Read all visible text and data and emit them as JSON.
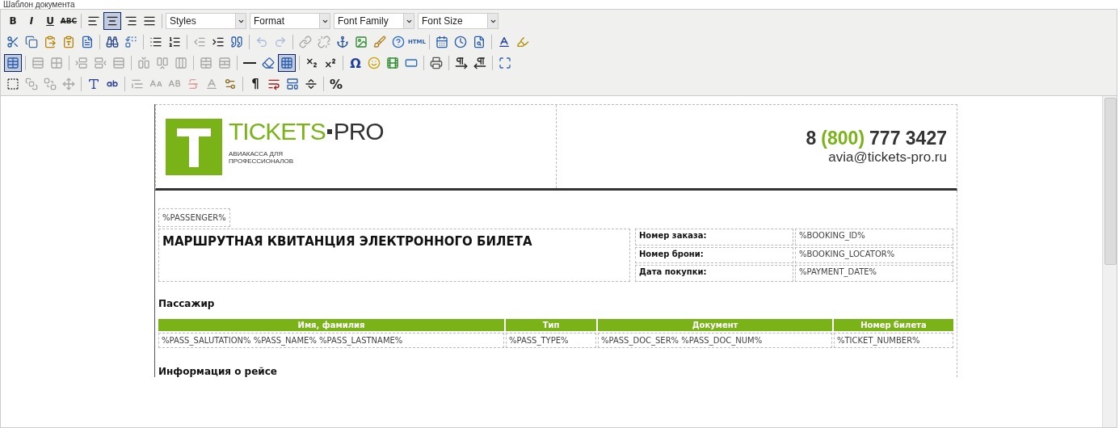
{
  "field_label": "Шаблон документа",
  "toolbar": {
    "rows": [
      [
        [
          {
            "kind": "bold",
            "label": "B",
            "disabled": false,
            "selected": false
          },
          {
            "kind": "italic",
            "label": "I",
            "disabled": false,
            "selected": false
          },
          {
            "kind": "underline",
            "label": "U",
            "disabled": false,
            "selected": false
          },
          {
            "kind": "strike",
            "label": "ABC",
            "disabled": false,
            "selected": false
          }
        ],
        [
          {
            "kind": "align-left",
            "disabled": false,
            "selected": false
          },
          {
            "kind": "align-center",
            "disabled": false,
            "selected": true
          },
          {
            "kind": "align-right",
            "disabled": false,
            "selected": false
          },
          {
            "kind": "justify",
            "disabled": false,
            "selected": false
          }
        ],
        [
          {
            "kind": "select",
            "label": "Styles"
          },
          {
            "kind": "select",
            "label": "Format"
          },
          {
            "kind": "select",
            "label": "Font Family"
          },
          {
            "kind": "select",
            "label": "Font Size"
          }
        ]
      ],
      [
        [
          {
            "kind": "cut",
            "disabled": false,
            "selected": false
          },
          {
            "kind": "copy",
            "disabled": false,
            "selected": false
          },
          {
            "kind": "paste",
            "disabled": false,
            "selected": false
          },
          {
            "kind": "paste-text",
            "disabled": false,
            "selected": false
          },
          {
            "kind": "paste-word",
            "disabled": false,
            "selected": false
          }
        ],
        [
          {
            "kind": "find",
            "disabled": false,
            "selected": false
          },
          {
            "kind": "replace",
            "disabled": false,
            "selected": false
          }
        ],
        [
          {
            "kind": "bullets",
            "disabled": false,
            "selected": false
          },
          {
            "kind": "numbers",
            "disabled": false,
            "selected": false
          }
        ],
        [
          {
            "kind": "outdent",
            "disabled": true,
            "selected": false
          },
          {
            "kind": "indent",
            "disabled": false,
            "selected": false
          },
          {
            "kind": "quote",
            "disabled": false,
            "selected": false
          }
        ],
        [
          {
            "kind": "undo",
            "disabled": true,
            "selected": false
          },
          {
            "kind": "redo",
            "disabled": true,
            "selected": false
          }
        ],
        [
          {
            "kind": "link",
            "disabled": true,
            "selected": false
          },
          {
            "kind": "unlink",
            "disabled": true,
            "selected": false
          },
          {
            "kind": "anchor",
            "disabled": false,
            "selected": false
          },
          {
            "kind": "image",
            "disabled": false,
            "selected": false
          },
          {
            "kind": "cleanup",
            "disabled": false,
            "selected": false
          },
          {
            "kind": "help",
            "disabled": false,
            "selected": false
          },
          {
            "kind": "html",
            "label": "HTML",
            "disabled": false,
            "selected": false
          }
        ],
        [
          {
            "kind": "date",
            "disabled": false,
            "selected": false
          },
          {
            "kind": "time",
            "disabled": false,
            "selected": false
          },
          {
            "kind": "preview",
            "disabled": false,
            "selected": false
          }
        ],
        [
          {
            "kind": "text-color",
            "disabled": false,
            "selected": false
          },
          {
            "kind": "highlight",
            "disabled": false,
            "selected": false
          }
        ]
      ],
      [
        [
          {
            "kind": "table",
            "disabled": false,
            "selected": true
          }
        ],
        [
          {
            "kind": "row-props",
            "disabled": true,
            "selected": false
          },
          {
            "kind": "cell-props",
            "disabled": true,
            "selected": false
          }
        ],
        [
          {
            "kind": "row-before",
            "disabled": true,
            "selected": false
          },
          {
            "kind": "row-after",
            "disabled": true,
            "selected": false
          },
          {
            "kind": "delete-row",
            "disabled": true,
            "selected": false
          }
        ],
        [
          {
            "kind": "col-before",
            "disabled": true,
            "selected": false
          },
          {
            "kind": "col-after",
            "disabled": true,
            "selected": false
          },
          {
            "kind": "delete-col",
            "disabled": true,
            "selected": false
          }
        ],
        [
          {
            "kind": "merge",
            "disabled": true,
            "selected": false
          },
          {
            "kind": "split",
            "disabled": true,
            "selected": false
          }
        ],
        [
          {
            "kind": "rule",
            "disabled": false,
            "selected": false
          },
          {
            "kind": "eraser",
            "disabled": false,
            "selected": false
          },
          {
            "kind": "visual-aid",
            "disabled": false,
            "selected": true
          }
        ],
        [
          {
            "kind": "subscript",
            "disabled": false,
            "selected": false
          },
          {
            "kind": "superscript",
            "disabled": false,
            "selected": false
          }
        ],
        [
          {
            "kind": "charmap",
            "label": "Ω",
            "disabled": false,
            "selected": false
          },
          {
            "kind": "emoticon",
            "disabled": false,
            "selected": false
          },
          {
            "kind": "media",
            "disabled": false,
            "selected": false
          },
          {
            "kind": "adv-rule",
            "disabled": false,
            "selected": false
          }
        ],
        [
          {
            "kind": "print",
            "disabled": false,
            "selected": false
          }
        ],
        [
          {
            "kind": "ltr",
            "disabled": false,
            "selected": false
          },
          {
            "kind": "rtl",
            "disabled": false,
            "selected": false
          }
        ],
        [
          {
            "kind": "fullscreen",
            "disabled": false,
            "selected": false
          }
        ]
      ],
      [
        [
          {
            "kind": "layer",
            "disabled": false,
            "selected": false
          },
          {
            "kind": "forward",
            "disabled": true,
            "selected": false
          },
          {
            "kind": "backward",
            "disabled": true,
            "selected": false
          },
          {
            "kind": "absolute",
            "disabled": true,
            "selected": false
          }
        ],
        [
          {
            "kind": "style-props",
            "disabled": false,
            "selected": false
          },
          {
            "kind": "spellcheck",
            "disabled": false,
            "selected": false
          }
        ],
        [
          {
            "kind": "cite",
            "disabled": true,
            "selected": false
          },
          {
            "kind": "abbr",
            "disabled": true,
            "selected": false
          },
          {
            "kind": "acronym",
            "disabled": true,
            "selected": false
          },
          {
            "kind": "del",
            "disabled": true,
            "selected": false
          },
          {
            "kind": "ins",
            "disabled": true,
            "selected": false
          },
          {
            "kind": "attributes",
            "disabled": false,
            "selected": false
          }
        ],
        [
          {
            "kind": "visual-chars",
            "label": "¶",
            "disabled": false,
            "selected": false
          },
          {
            "kind": "nonbreaking",
            "disabled": false,
            "selected": false
          },
          {
            "kind": "template",
            "disabled": false,
            "selected": false
          },
          {
            "kind": "page-break",
            "disabled": false,
            "selected": false
          }
        ],
        [
          {
            "kind": "percent",
            "label": "%",
            "disabled": false,
            "selected": false
          }
        ]
      ]
    ]
  },
  "document": {
    "brand_primary": "TICKETS",
    "brand_secondary": "PRO",
    "brand_tagline": "АВИАКАССА ДЛЯ\nПРОФЕССИОНАЛОВ",
    "phone_prefix": "8",
    "phone_code": "(800)",
    "phone_number": "777 3427",
    "email": "avia@tickets-pro.ru",
    "passenger_placeholder": "%PASSENGER%",
    "title": "МАРШРУТНАЯ КВИТАНЦИЯ ЭЛЕКТРОННОГО БИЛЕТА",
    "order_info": [
      {
        "label": "Номер заказа:",
        "value": "%BOOKING_ID%"
      },
      {
        "label": "Номер брони:",
        "value": "%BOOKING_LOCATOR%"
      },
      {
        "label": "Дата покупки:",
        "value": "%PAYMENT_DATE%"
      }
    ],
    "passenger_heading": "Пассажир",
    "passenger_table": {
      "columns": [
        "Имя, фамилия",
        "Тип",
        "Документ",
        "Номер билета"
      ],
      "rows": [
        [
          "%PASS_SALUTATION% %PASS_NAME% %PASS_LASTNAME%",
          "%PASS_TYPE%",
          "%PASS_DOC_SER% %PASS_DOC_NUM%",
          "%TICKET_NUMBER%"
        ]
      ]
    },
    "flight_heading": "Информация о рейсе"
  }
}
